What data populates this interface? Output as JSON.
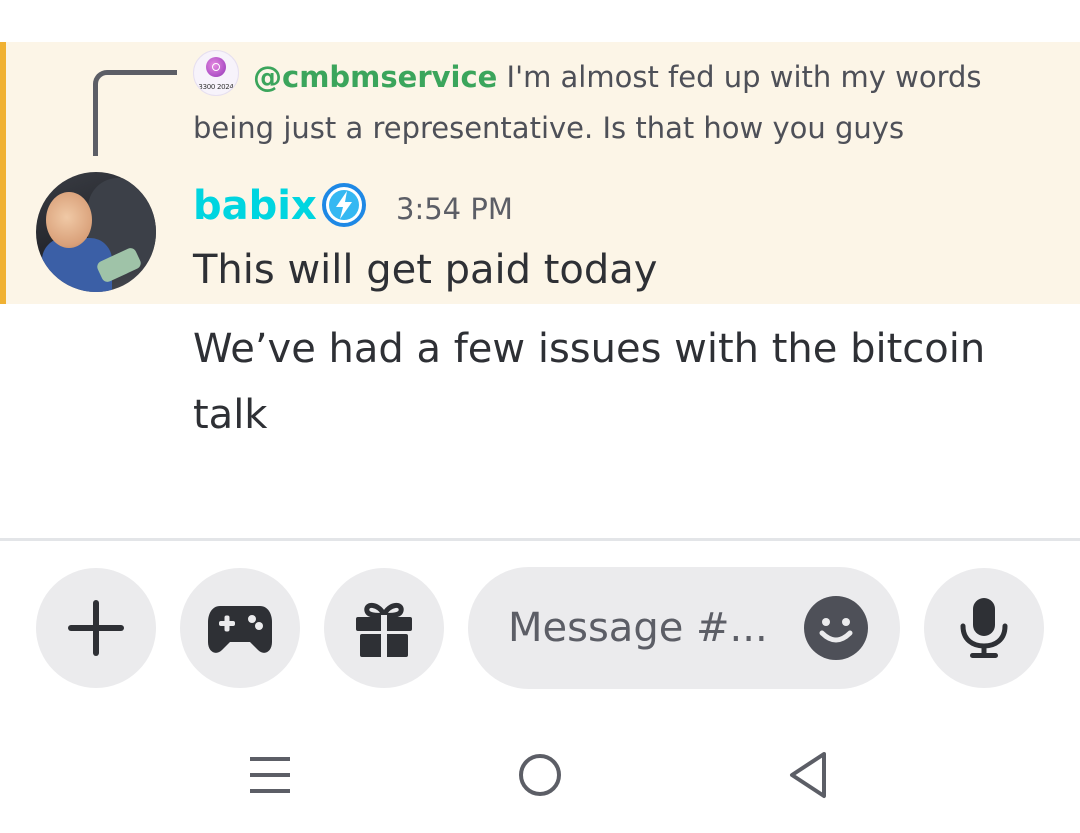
{
  "reply": {
    "avatar_icon": "service-logo-icon",
    "avatar_caption": "3300 2024",
    "author": "@cmbmservice",
    "text": "I'm almost fed up with my words being just a representative. Is that how you guys"
  },
  "message": {
    "avatar_icon": "user-photo-avatar",
    "username": "babix",
    "username_color": "#00d5e0",
    "badge_icon": "lightning-bolt-badge-icon",
    "timestamp": "3:54 PM",
    "lines": [
      "This will get paid today",
      "We’ve had a few issues with the bitcoin talk"
    ]
  },
  "highlight": {
    "background": "#fcf5e7",
    "bar_color": "#f0b132"
  },
  "composer": {
    "plus_icon": "plus-icon",
    "game_icon": "gamepad-icon",
    "gift_icon": "gift-icon",
    "placeholder": "Message #...",
    "emoji_icon": "emoji-smile-icon",
    "mic_icon": "microphone-icon"
  },
  "nav": {
    "menu_icon": "recent-apps-icon",
    "home_icon": "home-circle-icon",
    "back_icon": "back-triangle-icon"
  }
}
